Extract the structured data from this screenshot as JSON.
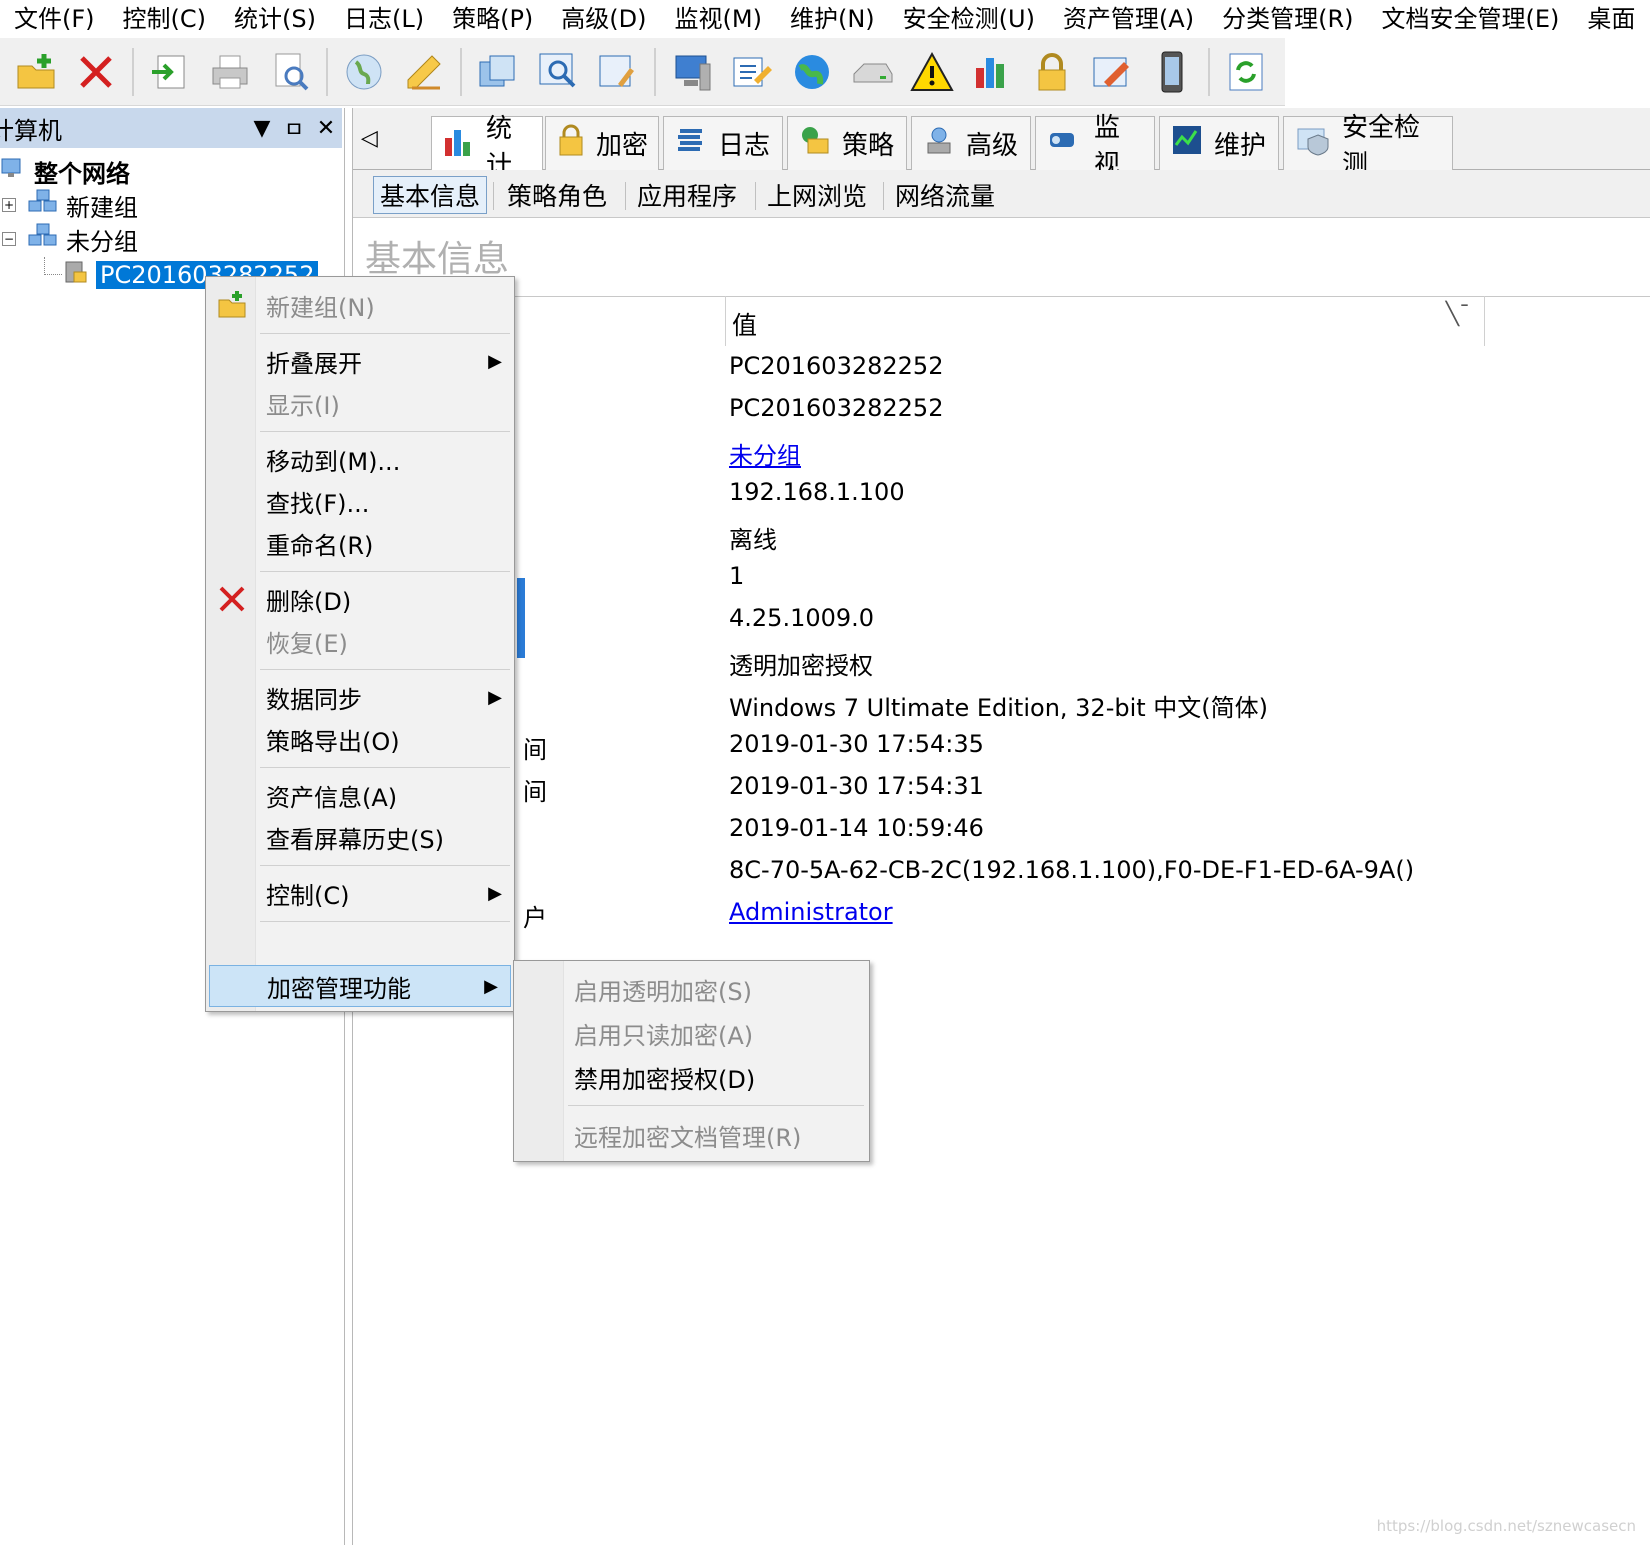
{
  "menubar": [
    "文件(F)",
    "控制(C)",
    "统计(S)",
    "日志(L)",
    "策略(P)",
    "高级(D)",
    "监视(M)",
    "维护(N)",
    "安全检测(U)",
    "资产管理(A)",
    "分类管理(R)",
    "文档安全管理(E)",
    "桌面"
  ],
  "toolbar": {
    "buttons": [
      "new-group-icon",
      "delete-icon",
      "import-icon",
      "print-icon",
      "print-preview-icon",
      "globe-icon",
      "note-icon",
      "copy-windows-icon",
      "search-window-icon",
      "window-edit-icon",
      "computer-icon",
      "report-icon",
      "internet-icon",
      "drive-icon",
      "warning-icon",
      "chart-icon",
      "lock-icon",
      "edit-doc-icon",
      "mobile-icon",
      "refresh-icon"
    ]
  },
  "left_panel": {
    "title": "计算机",
    "pin": "ㅁ",
    "close": "✕",
    "tree": {
      "root": "整个网络",
      "group1": "新建组",
      "group2": "未分组",
      "computer": "PC201603282252",
      "expand_plus": "+",
      "expand_minus": "−"
    }
  },
  "main_tabs": [
    "统计",
    "加密",
    "日志",
    "策略",
    "高级",
    "监视",
    "维护",
    "安全检测"
  ],
  "sub_tabs": [
    "基本信息",
    "策略角色",
    "应用程序",
    "上网浏览",
    "网络流量"
  ],
  "section_title": "基本信息",
  "details": {
    "value_header": "值",
    "label_fragments": [
      "间",
      "间",
      "户"
    ],
    "values": [
      "PC201603282252",
      "PC201603282252",
      "未分组",
      "192.168.1.100",
      "离线",
      "1",
      "4.25.1009.0",
      "透明加密授权",
      "Windows 7 Ultimate Edition, 32-bit 中文(简体)",
      "2019-01-30 17:54:35",
      "2019-01-30 17:54:31",
      "2019-01-14 10:59:46",
      "8C-70-5A-62-CB-2C(192.168.1.100),F0-DE-F1-ED-6A-9A()",
      "Administrator"
    ]
  },
  "context_menu": {
    "new_group": "新建组(N)",
    "collapse_expand": "折叠展开",
    "show": "显示(I)",
    "move_to": "移动到(M)...",
    "find": "查找(F)...",
    "rename": "重命名(R)",
    "delete": "删除(D)",
    "restore": "恢复(E)",
    "data_sync": "数据同步",
    "policy_export": "策略导出(O)",
    "asset_info": "资产信息(A)",
    "screen_history": "查看屏幕历史(S)",
    "control": "控制(C)",
    "encryption_mgmt": "加密管理功能",
    "arrow": "▶"
  },
  "submenu": {
    "enable_transparent": "启用透明加密(S)",
    "enable_readonly": "启用只读加密(A)",
    "disable_auth": "禁用加密授权(D)",
    "remote_docs": "远程加密文档管理(R)"
  },
  "watermark": "https://blog.csdn.net/sznewcasecn",
  "colors": {
    "selection": "#0078d7",
    "link": "#0000ee",
    "menu_highlight": "#cce4f7",
    "panel_title": "#c8d8ec"
  }
}
